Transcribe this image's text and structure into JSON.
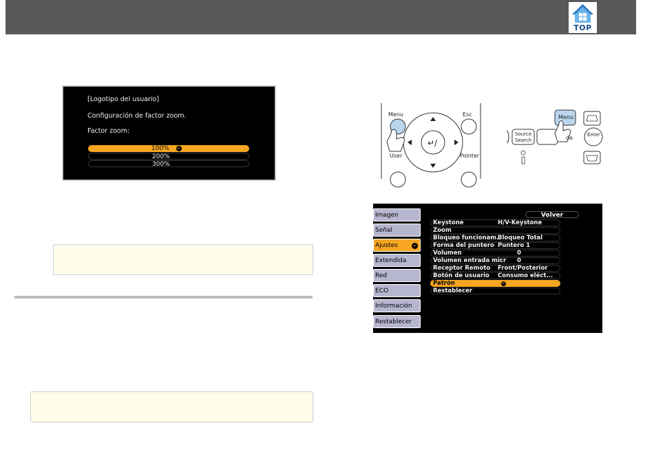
{
  "header": {
    "top_label": "TOP",
    "bg": "#58595b"
  },
  "zoom_screen": {
    "title": "[Logotipo del usuario]",
    "subtitle": "Configuración de factor zoom.",
    "factor_label": "Factor zoom:",
    "options": [
      {
        "label": "100%",
        "selected": true
      },
      {
        "label": "200%",
        "selected": false
      },
      {
        "label": "300%",
        "selected": false
      }
    ],
    "selected_color": "#f6a623"
  },
  "remote_left": {
    "menu": "Menu",
    "esc": "Esc",
    "user": "User",
    "pointer": "Pointer"
  },
  "remote_right": {
    "menu": "Menu",
    "source_l1": "Source",
    "source_l2": "Search",
    "enter": "Enter",
    "partial": "de"
  },
  "osd": {
    "tabs": [
      {
        "label": "Imagen",
        "active": false
      },
      {
        "label": "Señal",
        "active": false
      },
      {
        "label": "Ajustes",
        "active": true
      },
      {
        "label": "Extendida",
        "active": false
      },
      {
        "label": "Red",
        "active": false
      },
      {
        "label": "ECO",
        "active": false
      },
      {
        "label": "Información",
        "active": false
      },
      {
        "label": "Restablecer",
        "active": false
      }
    ],
    "back_label": "Volver",
    "rows": [
      {
        "label": "Keystone",
        "value": "H/V-Keystone",
        "selected": false
      },
      {
        "label": "Zoom",
        "value": "",
        "selected": false
      },
      {
        "label": "Bloqueo funcionam.",
        "value": "Bloqueo Total",
        "selected": false
      },
      {
        "label": "Forma del puntero",
        "value": "Puntero 1",
        "selected": false
      },
      {
        "label": "Volumen",
        "value": "0",
        "selected": false
      },
      {
        "label": "Volumen entrada micr",
        "value": "0",
        "selected": false
      },
      {
        "label": "Receptor Remoto",
        "value": "Front/Posterior",
        "selected": false
      },
      {
        "label": "Botón de usuario",
        "value": "Consumo eléct...",
        "selected": false
      },
      {
        "label": "Patrón",
        "value": "",
        "selected": true
      },
      {
        "label": "Restablecer",
        "value": "",
        "selected": false
      }
    ]
  }
}
